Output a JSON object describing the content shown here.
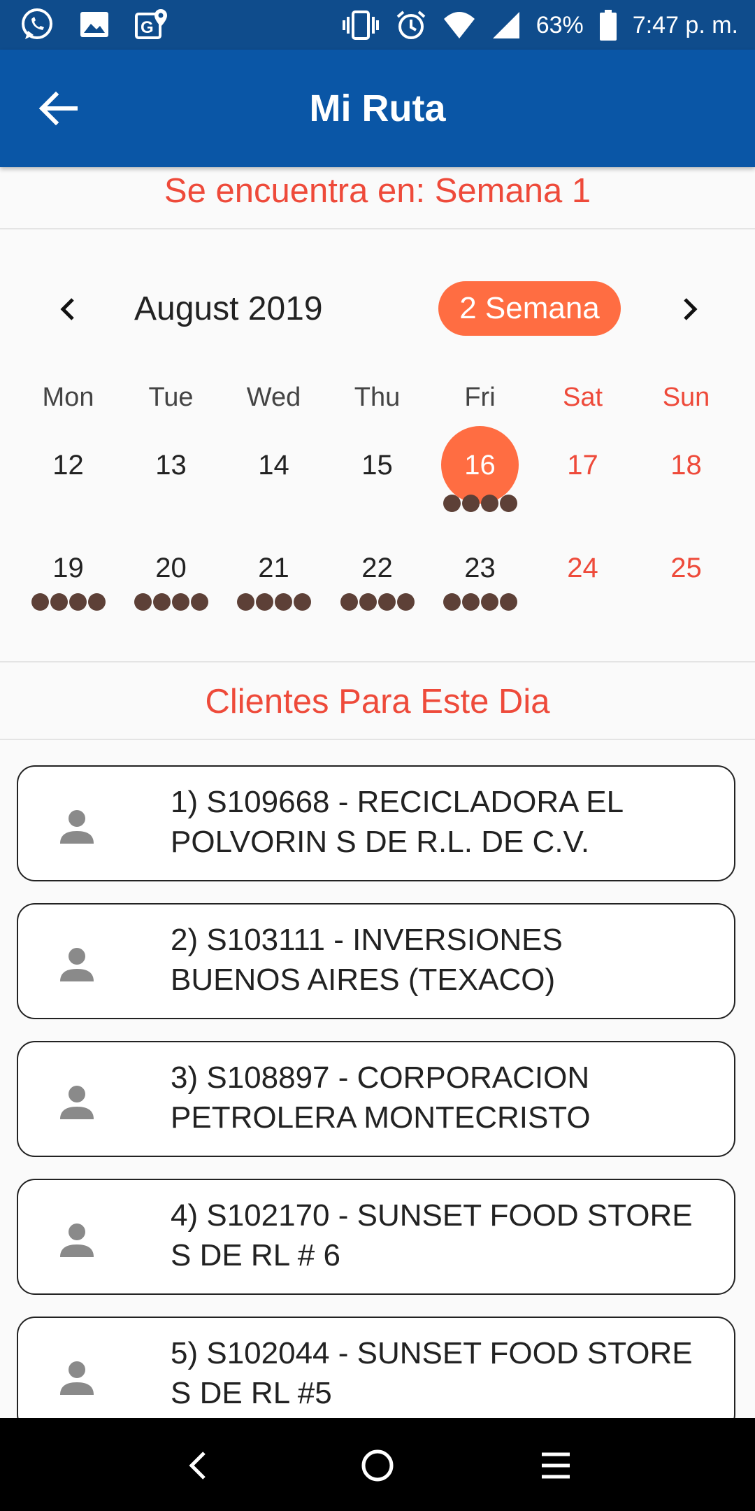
{
  "status_bar": {
    "battery": "63%",
    "time": "7:47 p. m.",
    "icons_left": [
      "whatsapp-icon",
      "gallery-icon",
      "maps-icon"
    ],
    "icons_right": [
      "vibrate-icon",
      "alarm-icon",
      "wifi-icon",
      "signal-icon",
      "battery-icon"
    ]
  },
  "app_bar": {
    "title": "Mi Ruta"
  },
  "week_info": "Se encuentra en: Semana 1",
  "calendar": {
    "month": "August 2019",
    "week_badge": "2 Semana",
    "weekdays": [
      "Mon",
      "Tue",
      "Wed",
      "Thu",
      "Fri",
      "Sat",
      "Sun"
    ],
    "weeks": [
      [
        "12",
        "13",
        "14",
        "15",
        "16",
        "17",
        "18"
      ],
      [
        "19",
        "20",
        "21",
        "22",
        "23",
        "24",
        "25"
      ]
    ],
    "selected_date": "16",
    "dots_per_day": {
      "16": 4,
      "19": 4,
      "20": 4,
      "21": 4,
      "22": 4,
      "23": 4
    },
    "colors": {
      "selected": "#ff6d42",
      "weekend": "#ee4a3a",
      "dot": "#5d4037"
    }
  },
  "clientes": {
    "title": "Clientes Para Este Dia",
    "items": [
      {
        "line1": "1) S109668 - RECICLADORA EL",
        "line2": "POLVORIN S DE R.L. DE C.V."
      },
      {
        "line1": "2) S103111 - INVERSIONES",
        "line2": "BUENOS AIRES (TEXACO)"
      },
      {
        "line1": "3) S108897 - CORPORACION",
        "line2": "PETROLERA MONTECRISTO"
      },
      {
        "line1": "4) S102170 - SUNSET FOOD STORE",
        "line2": "S DE RL # 6"
      },
      {
        "line1": "5) S102044 - SUNSET FOOD STORE",
        "line2": "S DE RL #5"
      }
    ]
  },
  "colors": {
    "primary": "#0a56a6",
    "status_bar": "#0f4c8c",
    "accent": "#ee4a3a"
  }
}
